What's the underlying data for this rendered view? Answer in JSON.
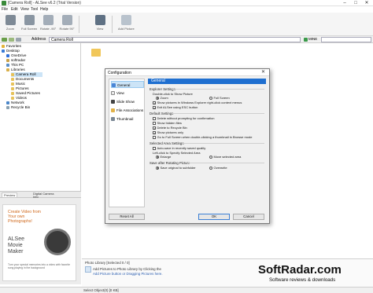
{
  "window": {
    "title": "[Camera Roll] - ALSee v6.2 (Trial Version)"
  },
  "menu": [
    "File",
    "Edit",
    "View",
    "Tool",
    "Help"
  ],
  "toolbar": {
    "buttons": [
      "Zoom",
      "Full Screen",
      "Rotate -90°",
      "Rotate 90°",
      "View",
      "Add Picture"
    ]
  },
  "address": {
    "label": "Address",
    "value": "Camera Roll",
    "view_mode": "MINE"
  },
  "tree": [
    "Favorites",
    "Desktop",
    "OneDrive",
    "softradar",
    "This PC",
    "Libraries",
    "Camera Roll",
    "Documents",
    "Music",
    "Pictures",
    "Saved Pictures",
    "Videos",
    "Network",
    "Recycle Bin"
  ],
  "preview_tabs": [
    "Preview",
    "Digital Camera Info"
  ],
  "ad": {
    "headline": "Create Video from Your own Photographs!",
    "product": "ALSee Movie Maker",
    "caption": "Turn your special memories into a video with favorite song playing in the background"
  },
  "dialog": {
    "title": "Configuration",
    "nav": [
      "General",
      "View",
      "Slide Show",
      "File Associations",
      "Thumbnail"
    ],
    "header": "General",
    "explorer_section": "Explorer Settings",
    "double_click_label": "Double-click to Show Picture",
    "radio_zoom": "Zoom",
    "radio_fullscreen": "Full Screen",
    "chk_context_menu": "Show pictures in Windows Explorer right-click context menus",
    "chk_exit_esc": "Exit ALSee using ESC button",
    "default_section": "Default Settings",
    "chk_delete_confirm": "Delete without prompting for confirmation",
    "chk_hidden": "Show hidden files",
    "chk_recycle": "Delete to Recycle Bin",
    "chk_pictures_only": "Show pictures only",
    "chk_fullscreen_thumb": "Go to Full Screen when double-clicking a thumbnail in Browse mode",
    "selected_section": "Selected Area Settings",
    "chk_auto_save": "Auto-save in recently saved quality",
    "left_click_label": "Left-click to Specify Selected Area",
    "radio_enlarge": "Enlarge",
    "radio_move_area": "Move selected area",
    "save_section": "Save after Rotating Picture",
    "radio_save_sub": "Save original to subfolder",
    "radio_overwrite": "Overwrite",
    "btn_reset": "Reset All",
    "btn_ok": "OK",
    "btn_cancel": "Cancel"
  },
  "photo_library": {
    "title": "Photo Library  [Selected 0 / 0]",
    "line1": "Add Pictures to Photo Library by Clicking the",
    "line2": "Add Picture button or Dragging Pictures here."
  },
  "status": {
    "text": "Select Object(0) [0 KB]"
  },
  "watermark": {
    "brand": "SoftRadar.com",
    "tagline": "Software reviews & downloads"
  }
}
